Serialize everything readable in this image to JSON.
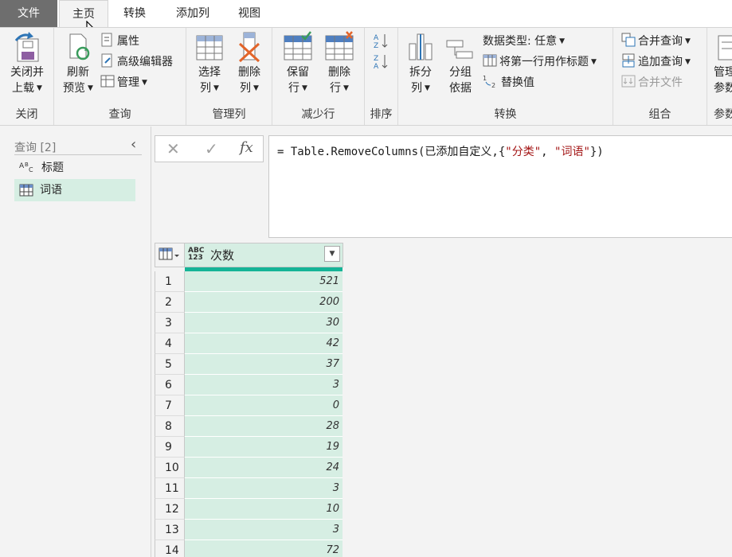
{
  "tabs": {
    "file": "文件",
    "home": "主页",
    "transform": "转换",
    "add_column": "添加列",
    "view": "视图"
  },
  "ribbon": {
    "close": {
      "btn_line1": "关闭并",
      "btn_line2": "上载",
      "label": "关闭"
    },
    "query": {
      "refresh_line1": "刷新",
      "refresh_line2": "预览",
      "properties": "属性",
      "advanced_editor": "高级编辑器",
      "manage": "管理",
      "label": "查询"
    },
    "manage_columns": {
      "choose_line1": "选择",
      "choose_line2": "列",
      "remove_line1": "删除",
      "remove_line2": "列",
      "label": "管理列"
    },
    "reduce_rows": {
      "keep_line1": "保留",
      "keep_line2": "行",
      "remove_line1": "删除",
      "remove_line2": "行",
      "label": "减少行"
    },
    "sort": {
      "label": "排序"
    },
    "transform": {
      "split_line1": "拆分",
      "split_line2": "列",
      "groupby_line1": "分组",
      "groupby_line2": "依据",
      "data_type": "数据类型: 任意",
      "first_row_headers": "将第一行用作标题",
      "replace_values": "替换值",
      "label": "转换"
    },
    "combine": {
      "merge": "合并查询",
      "append": "追加查询",
      "combine_files": "合并文件",
      "label": "组合"
    },
    "params": {
      "btn_line1": "管理",
      "btn_line2": "参数",
      "label": "参数"
    }
  },
  "queries_pane": {
    "header": "查询 [2]",
    "items": [
      {
        "label": "标题",
        "icon": "abc-text-icon"
      },
      {
        "label": "词语",
        "icon": "table-icon"
      }
    ]
  },
  "formula_bar": {
    "prefix": "= Table.RemoveColumns(已添加自定义,{",
    "arg1": "\"分类\"",
    "sep": ", ",
    "arg2": "\"词语\"",
    "suffix": "})"
  },
  "grid": {
    "column": {
      "type_top": "ABC",
      "type_bottom": "123",
      "name": "次数"
    },
    "rows": [
      {
        "n": "1",
        "v": "521"
      },
      {
        "n": "2",
        "v": "200"
      },
      {
        "n": "3",
        "v": "30"
      },
      {
        "n": "4",
        "v": "42"
      },
      {
        "n": "5",
        "v": "37"
      },
      {
        "n": "6",
        "v": "3"
      },
      {
        "n": "7",
        "v": "0"
      },
      {
        "n": "8",
        "v": "28"
      },
      {
        "n": "9",
        "v": "19"
      },
      {
        "n": "10",
        "v": "24"
      },
      {
        "n": "11",
        "v": "3"
      },
      {
        "n": "12",
        "v": "10"
      },
      {
        "n": "13",
        "v": "3"
      },
      {
        "n": "14",
        "v": "72"
      }
    ]
  },
  "colors": {
    "accent_green": "#d6eee3",
    "quality_bar": "#15b497",
    "file_tab": "#6e6e6e"
  }
}
